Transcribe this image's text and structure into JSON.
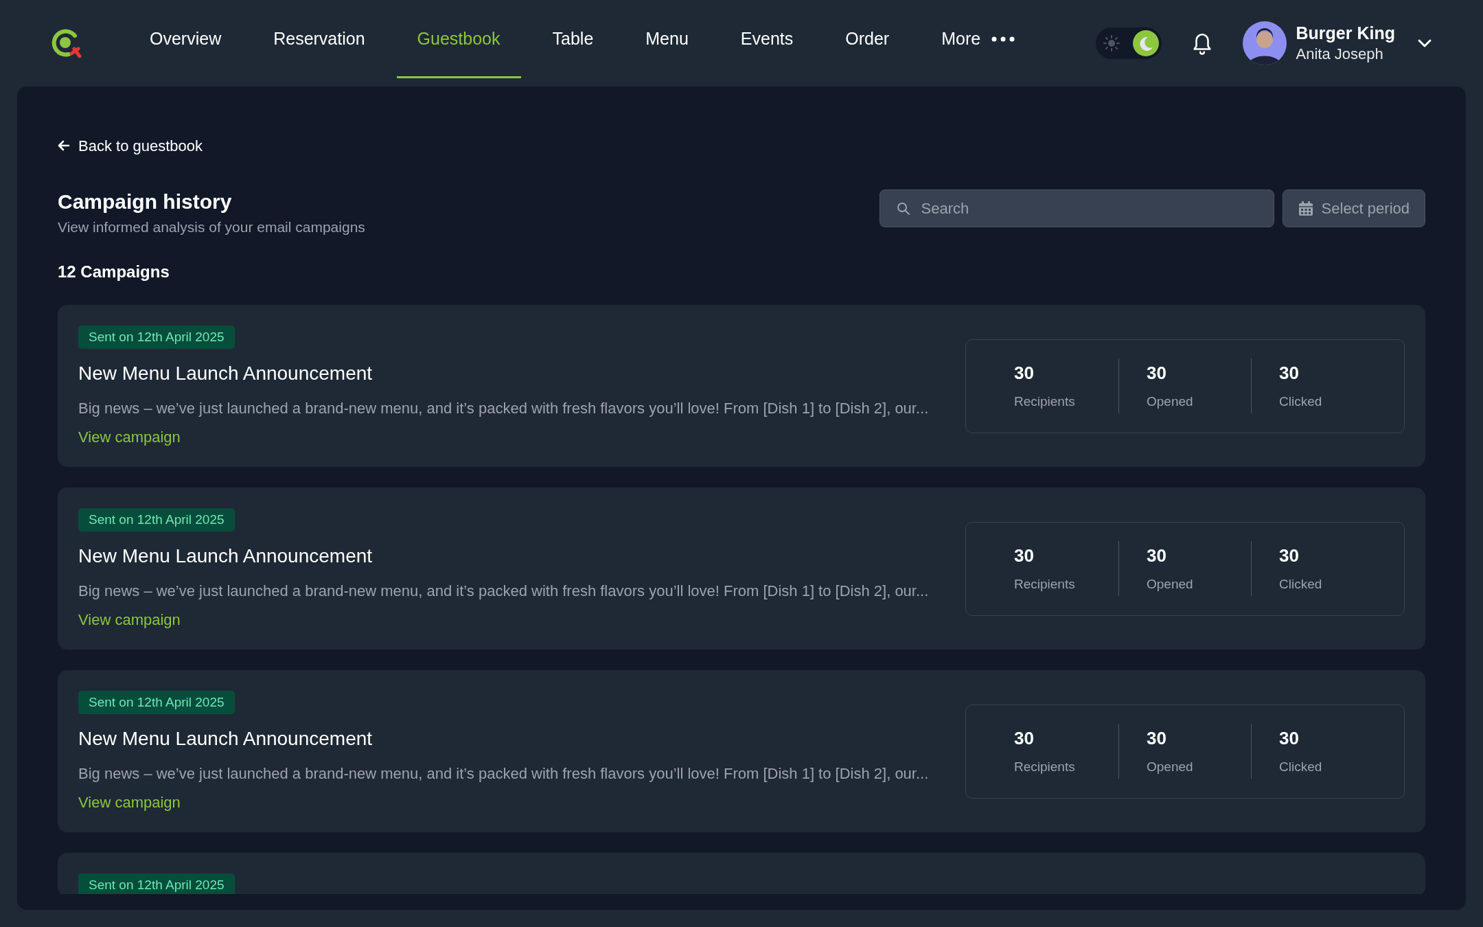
{
  "nav": {
    "items": [
      {
        "label": "Overview",
        "selected": false
      },
      {
        "label": "Reservation",
        "selected": false
      },
      {
        "label": "Guestbook",
        "selected": true
      },
      {
        "label": "Table",
        "selected": false
      },
      {
        "label": "Menu",
        "selected": false
      },
      {
        "label": "Events",
        "selected": false
      },
      {
        "label": "Order",
        "selected": false
      },
      {
        "label": "More",
        "selected": false
      }
    ],
    "dark_mode": true,
    "user": {
      "business": "Burger King",
      "name": "Anita Joseph"
    }
  },
  "back_link": "Back to guestbook",
  "page_title": "Campaign history",
  "page_subtitle": "View informed analysis of your email campaigns",
  "search": {
    "placeholder": "Search"
  },
  "period_button": "Select period",
  "count": "12 Campaigns",
  "campaigns": [
    {
      "date": "Sent on 12th April 2025",
      "title": "New Menu Launch Announcement",
      "summary": "Big news – we’ve just launched a brand-new menu, and it’s packed with fresh flavors you’ll love! From [Dish 1] to [Dish 2], our...",
      "link": "View campaign",
      "stats": [
        {
          "value": "30",
          "label": "Recipients"
        },
        {
          "value": "30",
          "label": "Opened"
        },
        {
          "value": "30",
          "label": "Clicked"
        }
      ]
    },
    {
      "date": "Sent on 12th April 2025",
      "title": "New Menu Launch Announcement",
      "summary": "Big news – we’ve just launched a brand-new menu, and it’s packed with fresh flavors you’ll love! From [Dish 1] to [Dish 2], our...",
      "link": "View campaign",
      "stats": [
        {
          "value": "30",
          "label": "Recipients"
        },
        {
          "value": "30",
          "label": "Opened"
        },
        {
          "value": "30",
          "label": "Clicked"
        }
      ]
    },
    {
      "date": "Sent on 12th April 2025",
      "title": "New Menu Launch Announcement",
      "summary": "Big news – we’ve just launched a brand-new menu, and it’s packed with fresh flavors you’ll love! From [Dish 1] to [Dish 2], our...",
      "link": "View campaign",
      "stats": [
        {
          "value": "30",
          "label": "Recipients"
        },
        {
          "value": "30",
          "label": "Opened"
        },
        {
          "value": "30",
          "label": "Clicked"
        }
      ]
    },
    {
      "date": "Sent on 12th April 2025"
    }
  ]
}
